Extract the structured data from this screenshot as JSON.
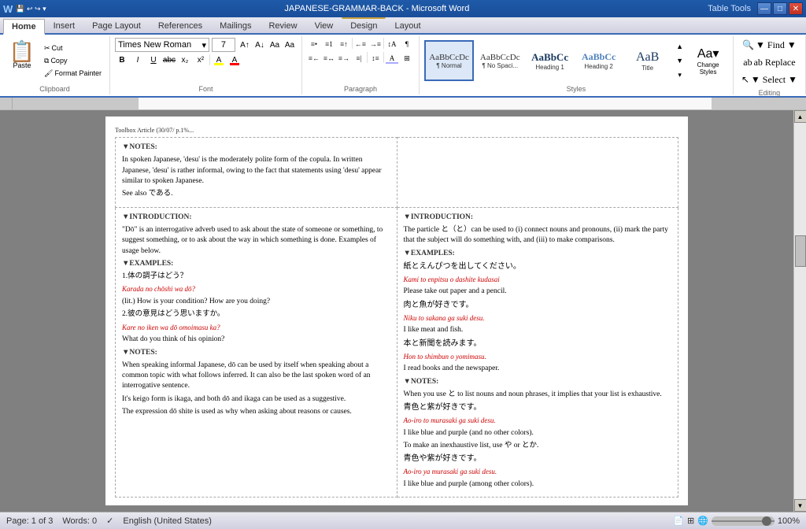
{
  "titleBar": {
    "appIcon": "W",
    "title": "JAPANESE-GRAMMAR-BACK - Microsoft Word",
    "tableTools": "Table Tools",
    "controls": [
      "—",
      "□",
      "✕"
    ]
  },
  "ribbonTabs": [
    "Home",
    "Insert",
    "Page Layout",
    "References",
    "Mailings",
    "Review",
    "View",
    "Design",
    "Layout"
  ],
  "activeTab": "Home",
  "clipboard": {
    "label": "Clipboard",
    "paste": "Paste",
    "cut": "Cut",
    "copy": "Copy",
    "formatPainter": "Format Painter"
  },
  "font": {
    "label": "Font",
    "name": "Times New Roman",
    "size": "7",
    "bold": "B",
    "italic": "I",
    "underline": "U",
    "strikethrough": "abc",
    "subscript": "x₂",
    "superscript": "x²",
    "case": "Aa",
    "highlight": "A",
    "color": "A"
  },
  "paragraph": {
    "label": "Paragraph"
  },
  "styles": {
    "label": "Styles",
    "items": [
      {
        "name": "Normal",
        "label": "AaBbCcDc",
        "subLabel": "¶ Normal",
        "active": true
      },
      {
        "name": "NoSpacing",
        "label": "AaBbCcDc",
        "subLabel": "¶ No Spaci..."
      },
      {
        "name": "Heading1",
        "label": "AaBbCc",
        "subLabel": "Heading 1"
      },
      {
        "name": "Heading2",
        "label": "AaBbCc",
        "subLabel": "Heading 2"
      },
      {
        "name": "Title",
        "label": "AaB",
        "subLabel": "Title"
      }
    ],
    "changeStyles": "Change\nStyles"
  },
  "editing": {
    "label": "Editing",
    "find": "▼ Find ▼",
    "replace": "ab Replace",
    "select": "▼ Select ▼"
  },
  "document": {
    "leftColumn": {
      "notesHeading": "▼NOTES:",
      "notesText": "In spoken Japanese, 'desu' is the moderately polite form of the copula. In written Japanese, 'desu' is rather informal, owing to the fact that statements using 'desu' appear similar to spoken Japanese.",
      "seeAlso": "See also である.",
      "introHeading": "▼INTRODUCTION:",
      "introText": "\"Dō\" is an interrogative adverb used to ask about the state of someone or something, to suggest something, or to ask about the way in which something is done. Examples of usage below.",
      "examplesHeading": "▼EXAMPLES:",
      "ex1jp": "1.体の調子はどう？",
      "ex1roman": "Karada no chōshi wa dō?",
      "ex1eng": "(lit.) How is your condition? How are you doing?",
      "ex2jp": "2.彼の意見はどう思いますか。",
      "ex2roman": "Kare no iken wa dō omoimasu ka?",
      "ex2eng": "What do you think of his opinion?",
      "notesHeading2": "▼NOTES:",
      "notes2p1": "When speaking informal Japanese, dō can be used by itself when speaking about a common topic with what follows inferred. It can also be the last spoken word of an interrogative sentence.",
      "notes2p2": "It's keigo form is ikaga, and both dō and ikaga can be used as a suggestive.",
      "notes2p3": "The expression dō shite is used as why when asking about reasons or causes."
    },
    "rightColumn": {
      "introHeading": "▼INTRODUCTION:",
      "introText": "The particle と（と）can be used to (i) connect nouns and pronouns, (ii) mark the party that the subject will do something with, and (iii) to make comparisons.",
      "examplesHeading": "▼EXAMPLES:",
      "ex1jp": "紙とえんぴつを出してください。",
      "ex1roman": "Kami to enpitsu o dashite kudasai",
      "ex1eng": "Please take out paper and a pencil.",
      "ex2jp": "肉と魚が好きです。",
      "ex2roman": "Niku to sakana ga suki desu.",
      "ex2eng": "I like meat and fish.",
      "ex3jp": "本と新聞を読みます。",
      "ex3roman": "Hon to shimbun o yomimasu.",
      "ex3eng": "I read books and the newspaper.",
      "notesHeading": "▼NOTES:",
      "notes1": "When you use と to list nouns and noun phrases, it implies that your list is exhaustive.",
      "ex4jp": "青色と紫が好きです。",
      "ex4roman": "Ao-iro to murasaki ga suki desu.",
      "ex4eng": "I like blue and purple (and no other colors).",
      "notes2intro": "To make an inexhaustive list, use や or とか.",
      "ex5jp": "青色や紫が好きです。",
      "ex5roman": "Ao-iro ya murasaki ga suki desu.",
      "ex5eng": "I like blue and purple (among other colors)."
    }
  },
  "statusBar": {
    "page": "Page: 1 of 3",
    "words": "Words: 0",
    "language": "English (United States)",
    "zoom": "100%"
  }
}
